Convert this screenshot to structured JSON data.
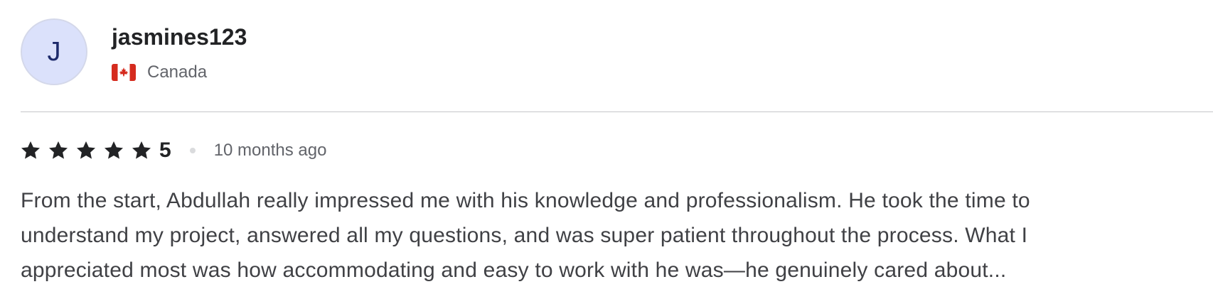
{
  "reviewer": {
    "avatar_initial": "J",
    "username": "jasmines123",
    "country": "Canada",
    "flag_icon": "canada-flag-icon"
  },
  "review": {
    "rating": "5",
    "stars_filled": 5,
    "stars_total": 5,
    "time_ago": "10 months ago",
    "text_lines": [
      "From the start, Abdullah really impressed me with his knowledge and professionalism. He took the time to",
      "understand my project, answered all my questions, and was super patient throughout the process. What I",
      "appreciated most was how accommodating and easy to work with he was—he genuinely cared about..."
    ]
  },
  "colors": {
    "avatar_bg": "#dbe1fb",
    "avatar_text": "#1d2a6b",
    "star": "#222325",
    "flag_red": "#d52b1e"
  }
}
